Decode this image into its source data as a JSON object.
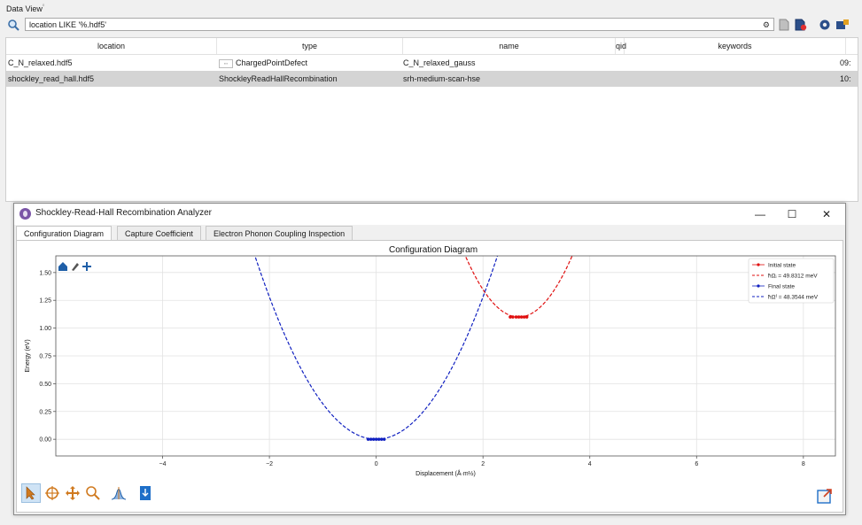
{
  "data_view": {
    "title": "Data View",
    "title_mark": "⁰",
    "search": {
      "value": "location LIKE '%.hdf5'"
    },
    "columns": [
      "location",
      "type",
      "name",
      "qid",
      "keywords"
    ],
    "rows": [
      {
        "location": "C_N_relaxed.hdf5",
        "type": "ChargedPointDefect",
        "name": "C_N_relaxed_gauss",
        "qid": "",
        "keywords": "",
        "extra": "09:"
      },
      {
        "location": "shockley_read_hall.hdf5",
        "type": "ShockleyReadHallRecombination",
        "name": "srh-medium-scan-hse",
        "qid": "",
        "keywords": "",
        "extra": "10:"
      }
    ]
  },
  "window": {
    "title": "Shockley-Read-Hall Recombination Analyzer",
    "controls": [
      "—",
      "☐",
      "✕"
    ],
    "tabs": [
      "Configuration Diagram",
      "Capture Coefficient",
      "Electron Phonon Coupling Inspection"
    ],
    "active_tab": 0
  },
  "chart_data": {
    "type": "line",
    "title": "Configuration Diagram",
    "xlabel": "Displacement (Å·m½)",
    "ylabel": "Energy (eV)",
    "xlim": [
      -6.0,
      8.6
    ],
    "ylim": [
      -0.15,
      1.65
    ],
    "xticks": [
      -4,
      -2,
      0,
      2,
      4,
      6,
      8
    ],
    "xtick_labels": [
      "−4",
      "−2",
      "0",
      "2",
      "4",
      "6",
      "8"
    ],
    "yticks": [
      0.0,
      0.25,
      0.5,
      0.75,
      1.0,
      1.25,
      1.5
    ],
    "ytick_labels": [
      "0.00",
      "0.25",
      "0.50",
      "0.75",
      "1.00",
      "1.25",
      "1.50"
    ],
    "grid": true,
    "legend_position": "top-right",
    "series": [
      {
        "name": "Initial state",
        "style": "points",
        "color": "#e01010",
        "x": [
          2.51,
          2.56,
          2.62,
          2.67,
          2.72,
          2.77,
          2.82
        ],
        "y": [
          1.1,
          1.1,
          1.1,
          1.1,
          1.1,
          1.1,
          1.1
        ]
      },
      {
        "name": "ħΩᵢ = 49.8312 meV",
        "style": "dashed",
        "color": "#e01010",
        "curve": {
          "x0": 2.67,
          "e0": 1.1,
          "k": 0.55,
          "x_range": [
            1.3,
            4.0
          ]
        }
      },
      {
        "name": "Final state",
        "style": "points",
        "color": "#1020c0",
        "x": [
          -0.15,
          -0.1,
          -0.05,
          0.0,
          0.05,
          0.1,
          0.15
        ],
        "y": [
          0.0,
          0.0,
          0.0,
          0.0,
          0.0,
          0.0,
          0.0
        ]
      },
      {
        "name": "ħΩᶠ = 48.3544 meV",
        "style": "dashed",
        "color": "#1020c0",
        "curve": {
          "x0": 0.0,
          "e0": 0.0,
          "k": 0.32,
          "x_range": [
            -2.5,
            2.5
          ]
        }
      }
    ]
  },
  "toolbar": {
    "tools": [
      "pointer-tool-icon",
      "target-tool-icon",
      "pan-tool-icon",
      "zoom-tool-icon",
      "peak-tool-icon",
      "save-tool-icon"
    ],
    "plot_nav": [
      "home-icon",
      "brush-icon",
      "move-icon"
    ]
  },
  "colors": {
    "accent": "#7b55a7",
    "selection": "#d4d4d4",
    "initial": "#e01010",
    "final": "#1020c0"
  }
}
